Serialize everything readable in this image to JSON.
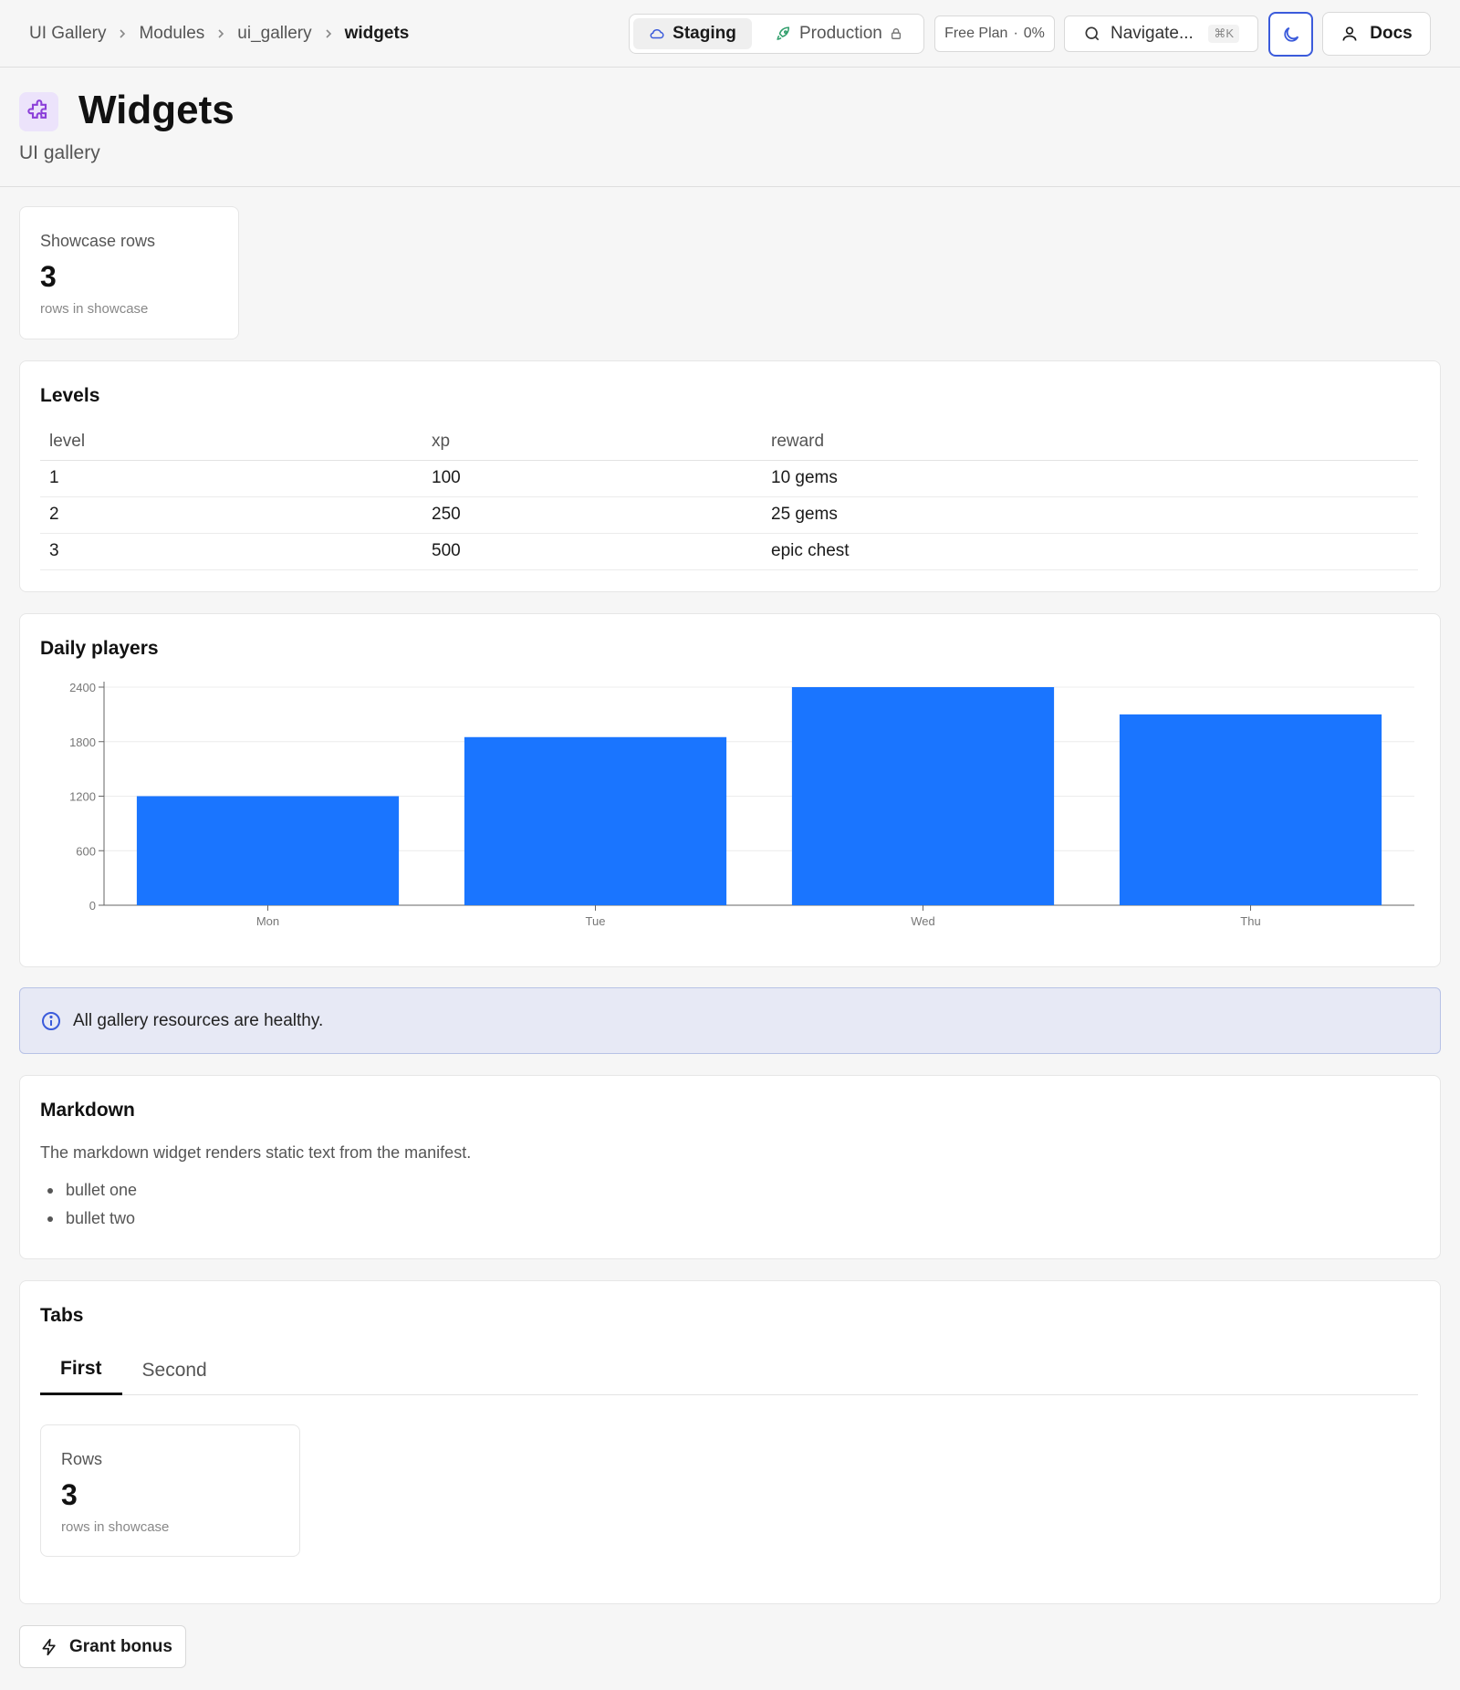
{
  "breadcrumb": [
    "UI Gallery",
    "Modules",
    "ui_gallery",
    "widgets"
  ],
  "env": {
    "staging": "Staging",
    "production": "Production"
  },
  "plan": {
    "name": "Free Plan",
    "usage": "0%"
  },
  "search": {
    "placeholder": "Navigate...",
    "shortcut": "⌘K"
  },
  "docs_label": "Docs",
  "page": {
    "title": "Widgets",
    "subtitle": "UI gallery"
  },
  "stat": {
    "label": "Showcase rows",
    "value": "3",
    "caption": "rows in showcase"
  },
  "levels": {
    "title": "Levels",
    "columns": [
      "level",
      "xp",
      "reward"
    ],
    "rows": [
      [
        "1",
        "100",
        "10 gems"
      ],
      [
        "2",
        "250",
        "25 gems"
      ],
      [
        "3",
        "500",
        "epic chest"
      ]
    ]
  },
  "chart_data": {
    "type": "bar",
    "title": "Daily players",
    "categories": [
      "Mon",
      "Tue",
      "Wed",
      "Thu"
    ],
    "values": [
      1200,
      1850,
      2400,
      2100
    ],
    "ylim": [
      0,
      2400
    ],
    "yticks": [
      "0",
      "600",
      "1200",
      "1800",
      "2400"
    ],
    "bar_color": "#1a75ff",
    "grid": true
  },
  "alert": {
    "text": "All gallery resources are healthy."
  },
  "markdown": {
    "title": "Markdown",
    "text": "The markdown widget renders static text from the manifest.",
    "bullets": [
      "bullet one",
      "bullet two"
    ]
  },
  "tabs": {
    "title": "Tabs",
    "items": [
      "First",
      "Second"
    ],
    "active_stat": {
      "label": "Rows",
      "value": "3",
      "caption": "rows in showcase"
    }
  },
  "grant_button": "Grant bonus",
  "colors": {
    "accent": "#3b5bdb",
    "module_icon": "#8b3fd9",
    "alert_bg": "#e7e9f5"
  }
}
